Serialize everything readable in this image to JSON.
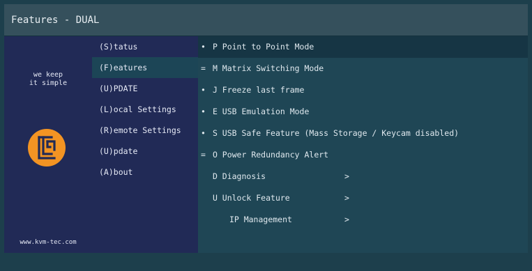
{
  "window": {
    "title": "Features - DUAL"
  },
  "brand": {
    "tagline_line1": "we keep",
    "tagline_line2": "it simple",
    "logo_icon": "kvm-logo-icon",
    "logo_color": "#f39423",
    "url": "www.kvm-tec.com"
  },
  "menu": {
    "items": [
      {
        "label": "(S)tatus"
      },
      {
        "label": "(F)eatures"
      },
      {
        "label": "(U)PDATE"
      },
      {
        "label": "(L)ocal   Settings"
      },
      {
        "label": "(R)emote Settings"
      },
      {
        "label": "(U)pdate"
      },
      {
        "label": "(A)bout"
      }
    ]
  },
  "features": {
    "rows": [
      {
        "bullet": "•",
        "text": "P Point to Point Mode",
        "arrow": ""
      },
      {
        "bullet": "=",
        "text": "M Matrix Switching Mode",
        "arrow": ""
      },
      {
        "bullet": "•",
        "text": "J Freeze last frame",
        "arrow": ""
      },
      {
        "bullet": "•",
        "text": "E USB Emulation Mode",
        "arrow": ""
      },
      {
        "bullet": "•",
        "text": "S USB Safe Feature (Mass Storage / Keycam disabled)",
        "arrow": ""
      },
      {
        "bullet": "=",
        "text": "O Power Redundancy Alert",
        "arrow": ""
      },
      {
        "bullet": "",
        "text": "D Diagnosis",
        "arrow": ">"
      },
      {
        "bullet": "",
        "text": "U Unlock Feature",
        "arrow": ">"
      },
      {
        "bullet": "",
        "text": "IP Management",
        "arrow": ">"
      }
    ]
  }
}
